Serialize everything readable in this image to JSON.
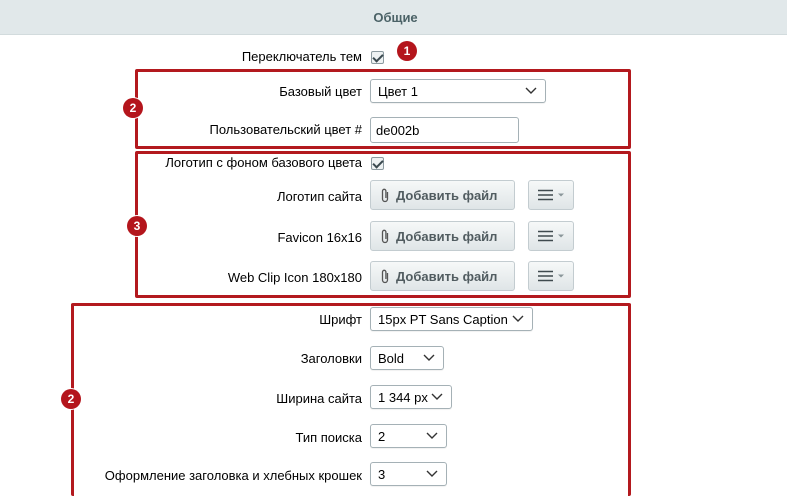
{
  "section": {
    "title": "Общие"
  },
  "theme_switcher": {
    "label": "Переключатель тем",
    "checked": true
  },
  "base_color": {
    "label": "Базовый цвет",
    "value": "Цвет 1"
  },
  "custom_color": {
    "label": "Пользовательский цвет #",
    "value": "de002b"
  },
  "logo_bg": {
    "label": "Логотип с фоном базового цвета",
    "checked": true
  },
  "site_logo": {
    "label": "Логотип сайта",
    "button": "Добавить файл"
  },
  "favicon": {
    "label": "Favicon 16x16",
    "button": "Добавить файл"
  },
  "webclip": {
    "label": "Web Clip Icon 180x180",
    "button": "Добавить файл"
  },
  "font": {
    "label": "Шрифт",
    "value": "15px PT Sans Caption"
  },
  "headings": {
    "label": "Заголовки",
    "value": "Bold"
  },
  "site_width": {
    "label": "Ширина сайта",
    "value": "1 344 px"
  },
  "search_type": {
    "label": "Тип поиска",
    "value": "2"
  },
  "breadcrumbs_style": {
    "label": "Оформление заголовка и хлебных крошек",
    "value": "3"
  },
  "badges": {
    "b1": "1",
    "b2a": "2",
    "b3": "3",
    "b2b": "2"
  },
  "colors": {
    "accent_red": "#b3191e",
    "header_bg": "#e1e8ea"
  }
}
